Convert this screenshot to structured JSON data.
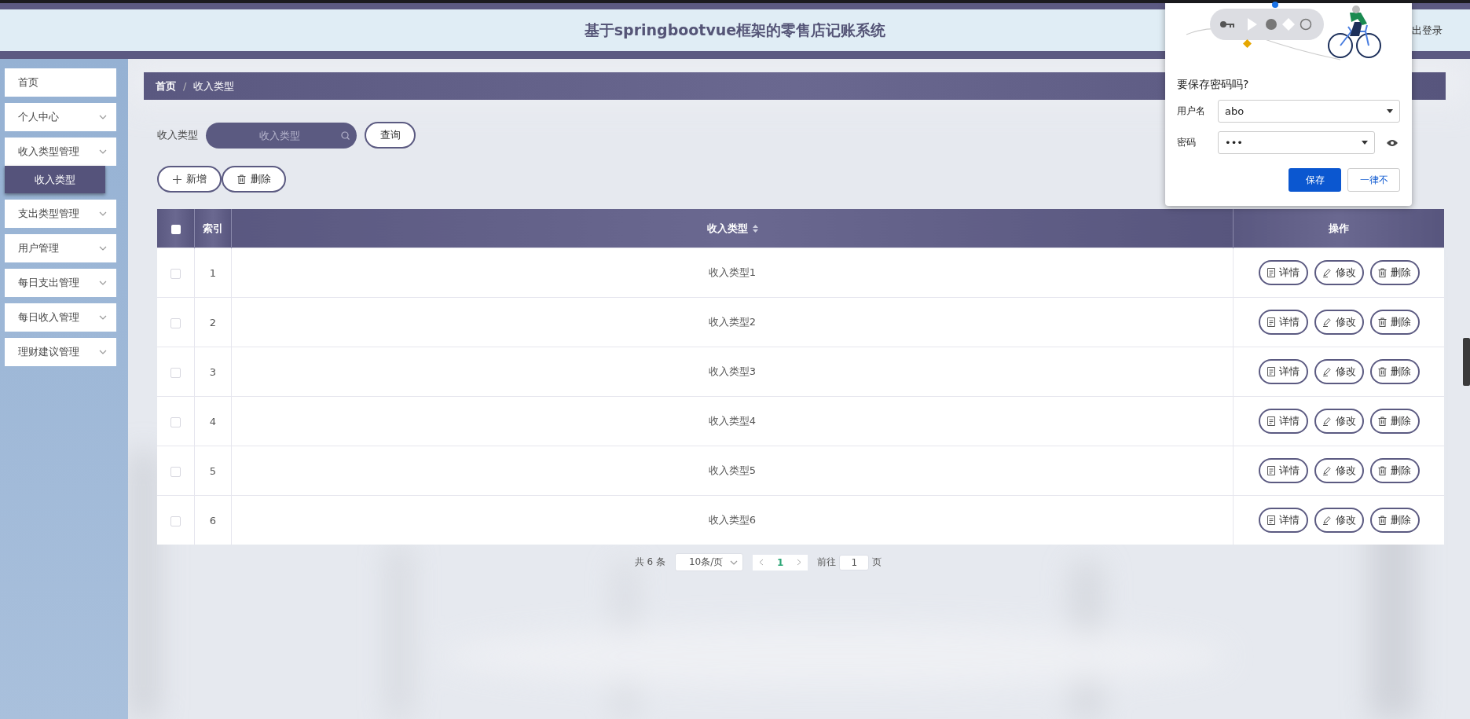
{
  "header": {
    "title": "基于springbootvue框架的零售店记账系统",
    "logout": "出登录"
  },
  "sidebar": {
    "items": [
      {
        "label": "首页",
        "kind": "link"
      },
      {
        "label": "个人中心",
        "kind": "menu"
      },
      {
        "label": "收入类型管理",
        "kind": "menu",
        "children": [
          {
            "label": "收入类型",
            "selected": true
          }
        ]
      },
      {
        "label": "支出类型管理",
        "kind": "menu"
      },
      {
        "label": "用户管理",
        "kind": "menu"
      },
      {
        "label": "每日支出管理",
        "kind": "menu"
      },
      {
        "label": "每日收入管理",
        "kind": "menu"
      },
      {
        "label": "理财建议管理",
        "kind": "menu"
      }
    ]
  },
  "breadcrumb": {
    "items": [
      "首页",
      "收入类型"
    ],
    "separator": "/"
  },
  "search": {
    "label": "收入类型",
    "placeholder": "收入类型",
    "button": "查询"
  },
  "toolbar": [
    {
      "label": "新增",
      "kind": "add"
    },
    {
      "label": "删除",
      "kind": "delete"
    }
  ],
  "table": {
    "select_all": {
      "checked": false
    },
    "columns": [
      {
        "label": "索引",
        "sortable": false
      },
      {
        "label": "收入类型",
        "sortable": true
      },
      {
        "label": "操作",
        "sortable": false
      }
    ],
    "rows": [
      {
        "checked": false,
        "index": "1",
        "type": "收入类型1",
        "actions": [
          {
            "label": "详情",
            "kind": "detail"
          },
          {
            "label": "修改",
            "kind": "edit"
          },
          {
            "label": "删除",
            "kind": "delete"
          }
        ]
      },
      {
        "checked": false,
        "index": "2",
        "type": "收入类型2",
        "actions": [
          {
            "label": "详情",
            "kind": "detail"
          },
          {
            "label": "修改",
            "kind": "edit"
          },
          {
            "label": "删除",
            "kind": "delete"
          }
        ]
      },
      {
        "checked": false,
        "index": "3",
        "type": "收入类型3",
        "actions": [
          {
            "label": "详情",
            "kind": "detail"
          },
          {
            "label": "修改",
            "kind": "edit"
          },
          {
            "label": "删除",
            "kind": "delete"
          }
        ]
      },
      {
        "checked": false,
        "index": "4",
        "type": "收入类型4",
        "actions": [
          {
            "label": "详情",
            "kind": "detail"
          },
          {
            "label": "修改",
            "kind": "edit"
          },
          {
            "label": "删除",
            "kind": "delete"
          }
        ]
      },
      {
        "checked": false,
        "index": "5",
        "type": "收入类型5",
        "actions": [
          {
            "label": "详情",
            "kind": "detail"
          },
          {
            "label": "修改",
            "kind": "edit"
          },
          {
            "label": "删除",
            "kind": "delete"
          }
        ]
      },
      {
        "checked": false,
        "index": "6",
        "type": "收入类型6",
        "actions": [
          {
            "label": "详情",
            "kind": "detail"
          },
          {
            "label": "修改",
            "kind": "edit"
          },
          {
            "label": "删除",
            "kind": "delete"
          }
        ]
      }
    ]
  },
  "pagination": {
    "total": "共 6 条",
    "page_size": "10条/页",
    "pages": [
      {
        "label": "1",
        "selected": true
      }
    ],
    "goto_label": "前往",
    "goto_value": "1",
    "page_unit": "页"
  },
  "password_popup": {
    "title": "要保存密码吗?",
    "fields": [
      {
        "label": "用户名",
        "value": "abo",
        "kind": "text"
      },
      {
        "label": "密码",
        "value": "•••",
        "kind": "password"
      }
    ],
    "buttons": [
      {
        "label": "保存",
        "kind": "primary"
      },
      {
        "label": "一律不",
        "kind": "secondary"
      }
    ]
  }
}
